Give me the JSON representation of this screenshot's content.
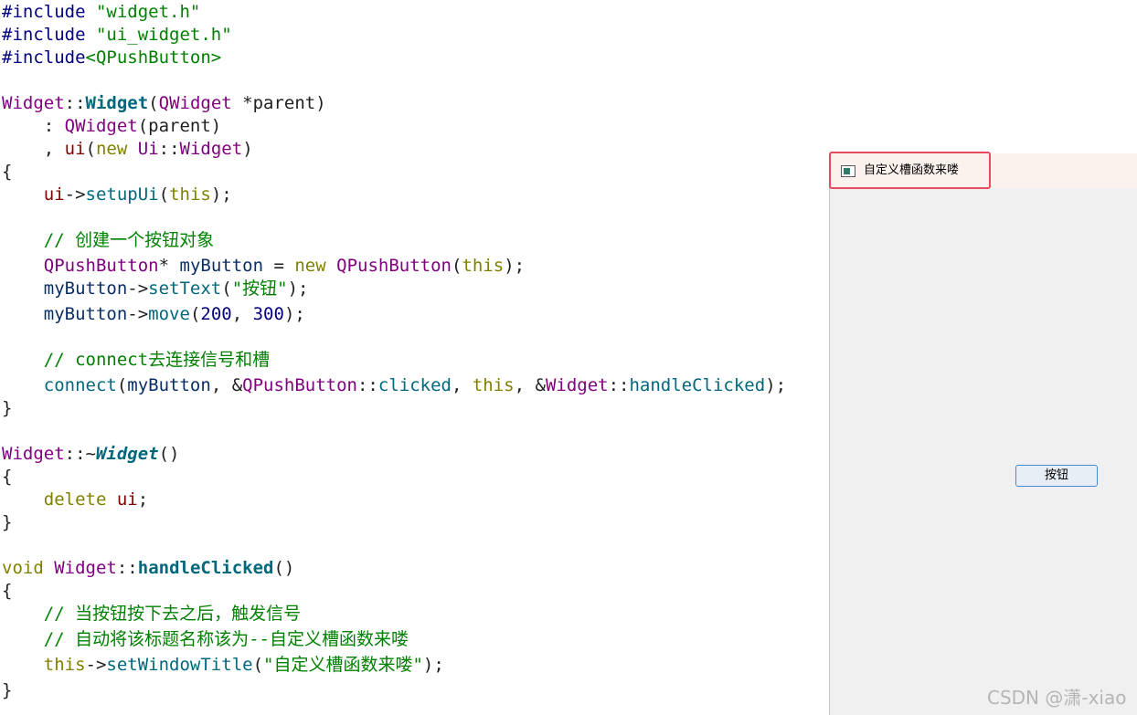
{
  "editor": {
    "lines": [
      [
        {
          "t": "#include",
          "c": "pre"
        },
        {
          "t": " ",
          "c": "ws"
        },
        {
          "t": "\"widget.h\"",
          "c": "inc"
        }
      ],
      [
        {
          "t": "#include",
          "c": "pre"
        },
        {
          "t": " ",
          "c": "ws"
        },
        {
          "t": "\"ui_widget.h\"",
          "c": "inc"
        }
      ],
      [
        {
          "t": "#include",
          "c": "pre"
        },
        {
          "t": "<QPushButton>",
          "c": "inc"
        }
      ],
      [],
      [
        {
          "t": "Widget",
          "c": "class"
        },
        {
          "t": "::",
          "c": "punc"
        },
        {
          "t": "Widget",
          "c": "funcdef"
        },
        {
          "t": "(",
          "c": "punc"
        },
        {
          "t": "QWidget",
          "c": "class"
        },
        {
          "t": " *parent)",
          "c": "punc"
        }
      ],
      [
        {
          "t": "    : ",
          "c": "punc"
        },
        {
          "t": "QWidget",
          "c": "class"
        },
        {
          "t": "(parent)",
          "c": "punc"
        }
      ],
      [
        {
          "t": "    , ",
          "c": "punc"
        },
        {
          "t": "ui",
          "c": "member"
        },
        {
          "t": "(",
          "c": "punc"
        },
        {
          "t": "new",
          "c": "kw"
        },
        {
          "t": " ",
          "c": "ws"
        },
        {
          "t": "Ui",
          "c": "class"
        },
        {
          "t": "::",
          "c": "punc"
        },
        {
          "t": "Widget",
          "c": "class"
        },
        {
          "t": ")",
          "c": "punc"
        }
      ],
      [
        {
          "t": "{",
          "c": "punc"
        }
      ],
      [
        {
          "t": "    ",
          "c": "ws"
        },
        {
          "t": "ui",
          "c": "member"
        },
        {
          "t": "->",
          "c": "punc"
        },
        {
          "t": "setupUi",
          "c": "func"
        },
        {
          "t": "(",
          "c": "punc"
        },
        {
          "t": "this",
          "c": "kw"
        },
        {
          "t": ");",
          "c": "punc"
        }
      ],
      [],
      [
        {
          "t": "    // 创建一个按钮对象",
          "c": "com"
        }
      ],
      [
        {
          "t": "    ",
          "c": "ws"
        },
        {
          "t": "QPushButton",
          "c": "class"
        },
        {
          "t": "* ",
          "c": "punc"
        },
        {
          "t": "myButton",
          "c": "var"
        },
        {
          "t": " = ",
          "c": "punc"
        },
        {
          "t": "new",
          "c": "kw"
        },
        {
          "t": " ",
          "c": "ws"
        },
        {
          "t": "QPushButton",
          "c": "class"
        },
        {
          "t": "(",
          "c": "punc"
        },
        {
          "t": "this",
          "c": "kw"
        },
        {
          "t": ");",
          "c": "punc"
        }
      ],
      [
        {
          "t": "    ",
          "c": "ws"
        },
        {
          "t": "myButton",
          "c": "var"
        },
        {
          "t": "->",
          "c": "punc"
        },
        {
          "t": "setText",
          "c": "func"
        },
        {
          "t": "(",
          "c": "punc"
        },
        {
          "t": "\"按钮\"",
          "c": "str"
        },
        {
          "t": ");",
          "c": "punc"
        }
      ],
      [
        {
          "t": "    ",
          "c": "ws"
        },
        {
          "t": "myButton",
          "c": "var"
        },
        {
          "t": "->",
          "c": "punc"
        },
        {
          "t": "move",
          "c": "func"
        },
        {
          "t": "(",
          "c": "punc"
        },
        {
          "t": "200",
          "c": "num"
        },
        {
          "t": ", ",
          "c": "punc"
        },
        {
          "t": "300",
          "c": "num"
        },
        {
          "t": ");",
          "c": "punc"
        }
      ],
      [],
      [
        {
          "t": "    // connect去连接信号和槽",
          "c": "com"
        }
      ],
      [
        {
          "t": "    ",
          "c": "ws"
        },
        {
          "t": "connect",
          "c": "func"
        },
        {
          "t": "(",
          "c": "punc"
        },
        {
          "t": "myButton",
          "c": "var"
        },
        {
          "t": ", &",
          "c": "punc"
        },
        {
          "t": "QPushButton",
          "c": "class"
        },
        {
          "t": "::",
          "c": "punc"
        },
        {
          "t": "clicked",
          "c": "func"
        },
        {
          "t": ", ",
          "c": "punc"
        },
        {
          "t": "this",
          "c": "kw"
        },
        {
          "t": ", &",
          "c": "punc"
        },
        {
          "t": "Widget",
          "c": "class"
        },
        {
          "t": "::",
          "c": "punc"
        },
        {
          "t": "handleClicked",
          "c": "func"
        },
        {
          "t": ");",
          "c": "punc"
        }
      ],
      [
        {
          "t": "}",
          "c": "punc"
        }
      ],
      [],
      [
        {
          "t": "Widget",
          "c": "class"
        },
        {
          "t": "::~",
          "c": "punc"
        },
        {
          "t": "Widget",
          "c": "dtor"
        },
        {
          "t": "()",
          "c": "punc"
        }
      ],
      [
        {
          "t": "{",
          "c": "punc"
        }
      ],
      [
        {
          "t": "    ",
          "c": "ws"
        },
        {
          "t": "delete",
          "c": "kw"
        },
        {
          "t": " ",
          "c": "ws"
        },
        {
          "t": "ui",
          "c": "member"
        },
        {
          "t": ";",
          "c": "punc"
        }
      ],
      [
        {
          "t": "}",
          "c": "punc"
        }
      ],
      [],
      [
        {
          "t": "void",
          "c": "kw"
        },
        {
          "t": " ",
          "c": "ws"
        },
        {
          "t": "Widget",
          "c": "class"
        },
        {
          "t": "::",
          "c": "punc"
        },
        {
          "t": "handleClicked",
          "c": "funcdef"
        },
        {
          "t": "()",
          "c": "punc"
        }
      ],
      [
        {
          "t": "{",
          "c": "punc"
        }
      ],
      [
        {
          "t": "    // 当按钮按下去之后，触发信号",
          "c": "com"
        }
      ],
      [
        {
          "t": "    // 自动将该标题名称该为--自定义槽函数来喽",
          "c": "com"
        }
      ],
      [
        {
          "t": "    ",
          "c": "ws"
        },
        {
          "t": "this",
          "c": "kw"
        },
        {
          "t": "->",
          "c": "punc"
        },
        {
          "t": "setWindowTitle",
          "c": "func"
        },
        {
          "t": "(",
          "c": "punc"
        },
        {
          "t": "\"自定义槽函数来喽\"",
          "c": "str"
        },
        {
          "t": ");",
          "c": "punc"
        }
      ],
      [
        {
          "t": "}",
          "c": "punc"
        }
      ]
    ]
  },
  "app_window": {
    "title": "自定义槽函数来喽",
    "icon": "window-app-icon",
    "button_label": "按钮"
  },
  "watermark": "CSDN @潇-xiao",
  "colors": {
    "class": "#800080",
    "function": "#00677c",
    "keyword": "#808000",
    "comment": "#008000",
    "highlight_border": "#e64b60"
  }
}
